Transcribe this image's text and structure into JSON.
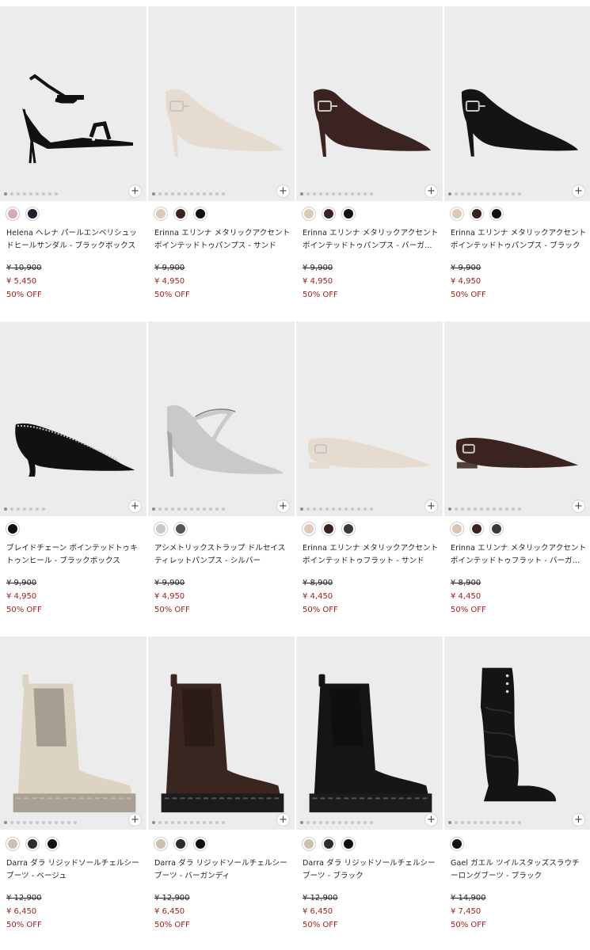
{
  "products": [
    {
      "name": "Helena ヘレナ パールエンベリシュッドヒールサンダル - ブラックボックス",
      "original_price": "¥ 10,900",
      "sale_price": "¥ 5,450",
      "discount": "50% OFF",
      "swatches": [
        "#d9a7bd",
        "#1d2230"
      ],
      "image": "strappy-sandal",
      "shoe_color": "#111111",
      "dots": 9
    },
    {
      "name": "Erinna エリンナ メタリックアクセント ポインテッドトゥパンプス - サンド",
      "original_price": "¥ 9,900",
      "sale_price": "¥ 4,950",
      "discount": "50% OFF",
      "swatches": [
        "#dccab7",
        "#3b2420",
        "#111111"
      ],
      "image": "pointed-pump",
      "shoe_color": "#e6dbcf",
      "dots": 12
    },
    {
      "name": "Erinna エリンナ メタリックアクセント ポインテッドトゥパンプス - バーガンディ",
      "original_price": "¥ 9,900",
      "sale_price": "¥ 4,950",
      "discount": "50% OFF",
      "swatches": [
        "#dccab7",
        "#3b2420",
        "#111111"
      ],
      "image": "pointed-pump",
      "shoe_color": "#3a2320",
      "dots": 12
    },
    {
      "name": "Erinna エリンナ メタリックアクセント ポインテッドトゥパンプス - ブラック",
      "original_price": "¥ 9,900",
      "sale_price": "¥ 4,950",
      "discount": "50% OFF",
      "swatches": [
        "#dccab7",
        "#3b2420",
        "#111111"
      ],
      "image": "pointed-pump",
      "shoe_color": "#141414",
      "dots": 12
    },
    {
      "name": "ブレイドチェーン ポインテッドトゥキトゥンヒール - ブラックボックス",
      "original_price": "¥ 9,900",
      "sale_price": "¥ 4,950",
      "discount": "50% OFF",
      "swatches": [
        "#111111"
      ],
      "image": "kitten-heel",
      "shoe_color": "#111111",
      "dots": 7
    },
    {
      "name": "アシメトリックストラップ ドルセイスティレットパンプス - シルバー",
      "original_price": "¥ 9,900",
      "sale_price": "¥ 4,950",
      "discount": "50% OFF",
      "swatches": [
        "#c7c7c7",
        "#555555"
      ],
      "image": "asym-pump",
      "shoe_color": "#c9c9c9",
      "dots": 12
    },
    {
      "name": "Erinna エリンナ メタリックアクセント ポインテッドトゥフラット - サンド",
      "original_price": "¥ 8,900",
      "sale_price": "¥ 4,450",
      "discount": "50% OFF",
      "swatches": [
        "#dccab7",
        "#3b2420",
        "#3a3a3a"
      ],
      "image": "flat",
      "shoe_color": "#e6dbcf",
      "dots": 12
    },
    {
      "name": "Erinna エリンナ メタリックアクセント ポインテッドトゥフラット - バーガンディ",
      "original_price": "¥ 8,900",
      "sale_price": "¥ 4,450",
      "discount": "50% OFF",
      "swatches": [
        "#dcc2b7",
        "#3b2420",
        "#3a3a3a"
      ],
      "image": "flat",
      "shoe_color": "#3a2320",
      "dots": 12
    },
    {
      "name": "Darra ダラ リジッドソールチェルシーブーツ - ベージュ",
      "original_price": "¥ 12,900",
      "sale_price": "¥ 6,450",
      "discount": "50% OFF",
      "swatches": [
        "#cbbfae",
        "#2d2d2d",
        "#111111"
      ],
      "image": "chelsea-boot",
      "shoe_color": "#ddd3c3",
      "sole_color": "#a9a093",
      "dots": 12
    },
    {
      "name": "Darra ダラ リジッドソールチェルシーブーツ - バーガンディ",
      "original_price": "¥ 12,900",
      "sale_price": "¥ 6,450",
      "discount": "50% OFF",
      "swatches": [
        "#cbbfae",
        "#2d2d2d",
        "#111111"
      ],
      "image": "chelsea-boot",
      "shoe_color": "#3a2620",
      "sole_color": "#1c1c1c",
      "dots": 12
    },
    {
      "name": "Darra ダラ リジッドソールチェルシーブーツ - ブラック",
      "original_price": "¥ 12,900",
      "sale_price": "¥ 6,450",
      "discount": "50% OFF",
      "swatches": [
        "#cbbfae",
        "#2d2d2d",
        "#111111"
      ],
      "image": "chelsea-boot",
      "shoe_color": "#151515",
      "sole_color": "#1c1c1c",
      "dots": 12
    },
    {
      "name": "Gael ガエル ツイルスタッズスラウチーロングブーツ - ブラック",
      "original_price": "¥ 14,900",
      "sale_price": "¥ 7,450",
      "discount": "50% OFF",
      "swatches": [
        "#111111"
      ],
      "image": "long-boot",
      "shoe_color": "#141414",
      "dots": 12
    }
  ],
  "add_button_label": "+"
}
